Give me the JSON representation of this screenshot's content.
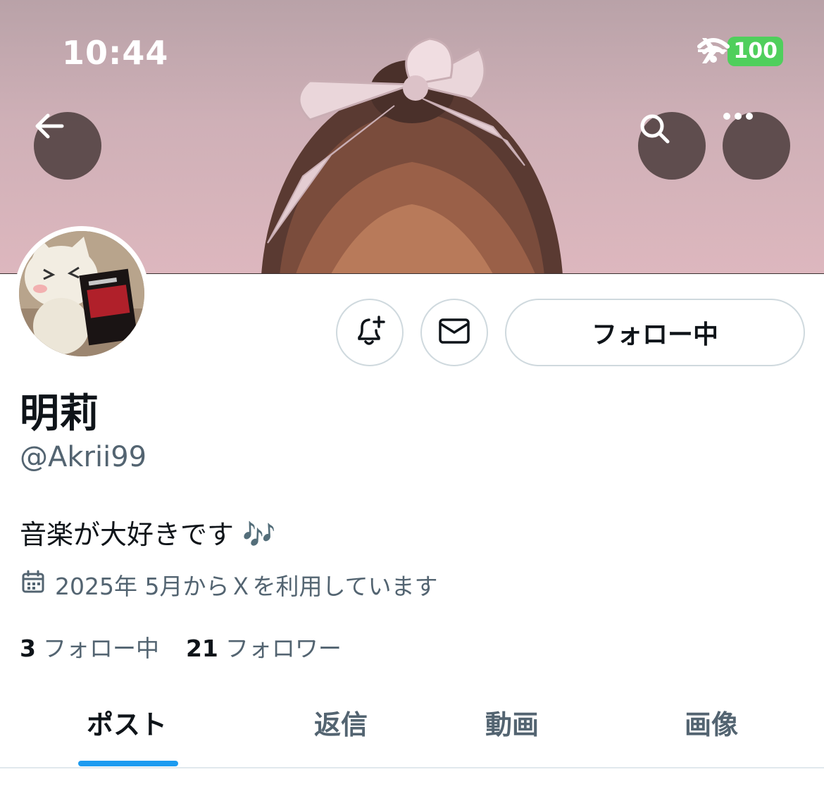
{
  "status_bar": {
    "time": "10:44",
    "battery": "100",
    "icons": [
      "airplane-icon",
      "wifi-icon",
      "battery-icon"
    ]
  },
  "header": {
    "back_icon": "back-arrow-icon",
    "search_icon": "search-icon",
    "more_icon": "more-icon"
  },
  "actions": {
    "notify_icon": "bell-plus-icon",
    "message_icon": "mail-icon",
    "follow_label": "フォロー中"
  },
  "profile": {
    "display_name": "明莉",
    "handle": "@Akrii99",
    "bio": "音楽が大好きです 🎶",
    "joined": "2025年 5月からＸを利用しています",
    "following_count": "3",
    "following_label": "フォロー中",
    "followers_count": "21",
    "followers_label": "フォロワー"
  },
  "tabs": [
    {
      "label": "ポスト",
      "active": true
    },
    {
      "label": "返信",
      "active": false
    },
    {
      "label": "動画",
      "active": false
    },
    {
      "label": "画像",
      "active": false
    }
  ],
  "colors": {
    "accent": "#1d9bf0",
    "secondary_text": "#536471",
    "primary_text": "#0f1419",
    "border": "#cfd9de",
    "battery": "#4fcf5c"
  }
}
